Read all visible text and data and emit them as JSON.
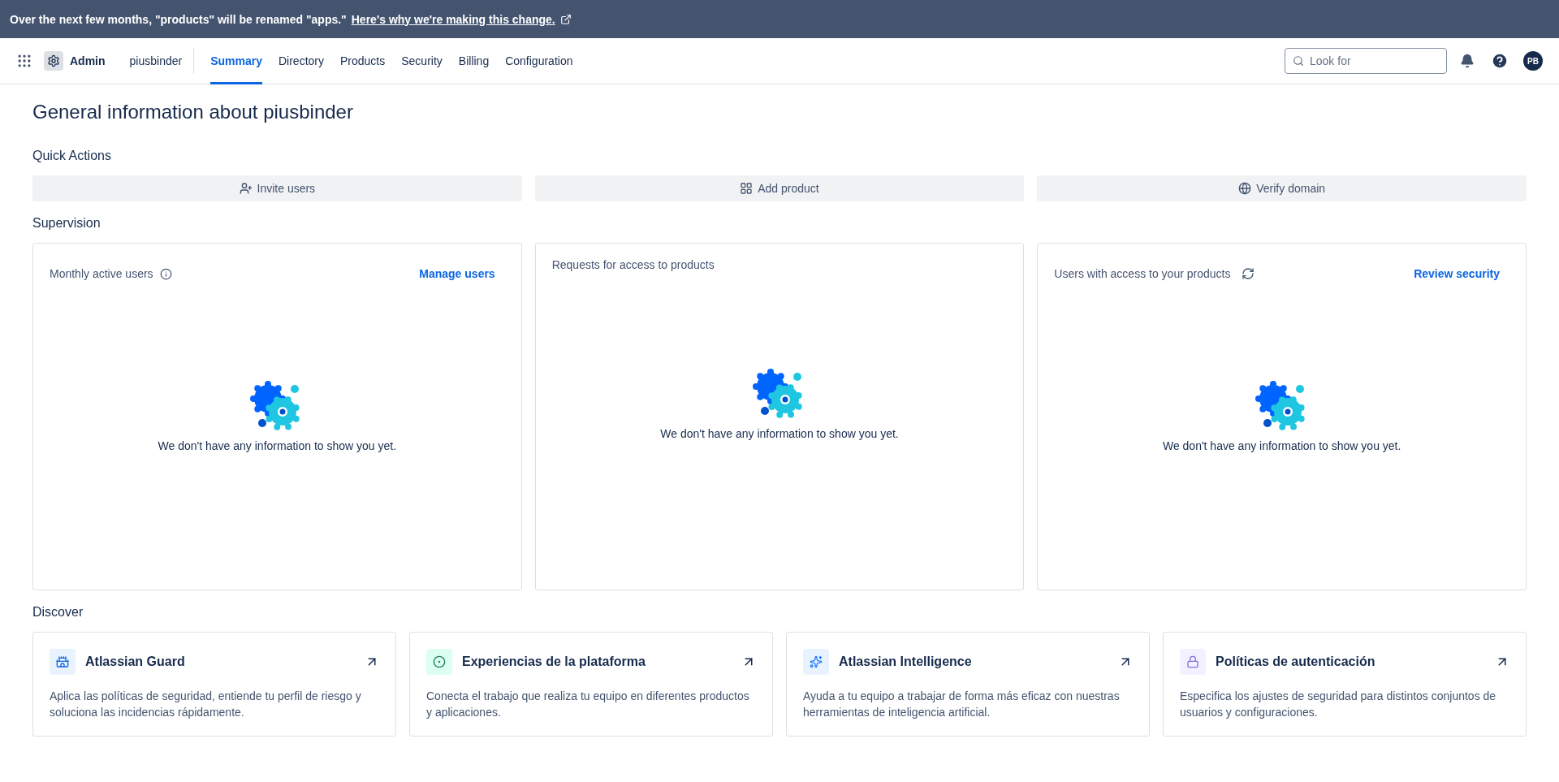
{
  "banner": {
    "text": "Over the next few months, \"products\" will be renamed \"apps.\"",
    "link": "Here's why we're making this change."
  },
  "nav": {
    "app": "Admin",
    "org": "piusbinder",
    "tabs": [
      {
        "label": "Summary",
        "selected": true
      },
      {
        "label": "Directory",
        "selected": false
      },
      {
        "label": "Products",
        "selected": false
      },
      {
        "label": "Security",
        "selected": false
      },
      {
        "label": "Billing",
        "selected": false
      },
      {
        "label": "Configuration",
        "selected": false
      }
    ],
    "search": {
      "placeholder": "Look for"
    },
    "avatar": "PB"
  },
  "title": "General information about piusbinder",
  "quick_actions": {
    "heading": "Quick Actions",
    "items": [
      {
        "kind": "invite",
        "label": "Invite users"
      },
      {
        "kind": "product",
        "label": "Add product"
      },
      {
        "kind": "globe",
        "label": "Verify domain"
      }
    ]
  },
  "supervision": {
    "heading": "Supervision",
    "cards": [
      {
        "kind": "info",
        "title": "Monthly active users",
        "link": "Manage users",
        "empty": "We don't have any information to show you yet."
      },
      {
        "kind": "plain",
        "title": "Requests for access to products",
        "empty": "We don't have any information to show you yet."
      },
      {
        "kind": "refresh",
        "title": "Users with access to your products",
        "link": "Review security",
        "empty": "We don't have any information to show you yet."
      }
    ]
  },
  "discover": {
    "heading": "Discover",
    "cards": [
      {
        "kind": "guard",
        "title": "Atlassian Guard",
        "text": "Aplica las políticas de seguridad, entiende tu perfil de riesgo y soluciona las incidencias rápidamente."
      },
      {
        "kind": "platform",
        "title": "Experiencias de la plataforma",
        "text": "Conecta el trabajo que realiza tu equipo en diferentes productos y aplicaciones."
      },
      {
        "kind": "ai",
        "title": "Atlassian Intelligence",
        "text": "Ayuda a tu equipo a trabajar de forma más eficaz con nuestras herramientas de inteligencia artificial."
      },
      {
        "kind": "lock",
        "title": "Políticas de autenticación",
        "text": "Especifica los ajustes de seguridad para distintos conjuntos de usuarios y configuraciones."
      }
    ]
  }
}
